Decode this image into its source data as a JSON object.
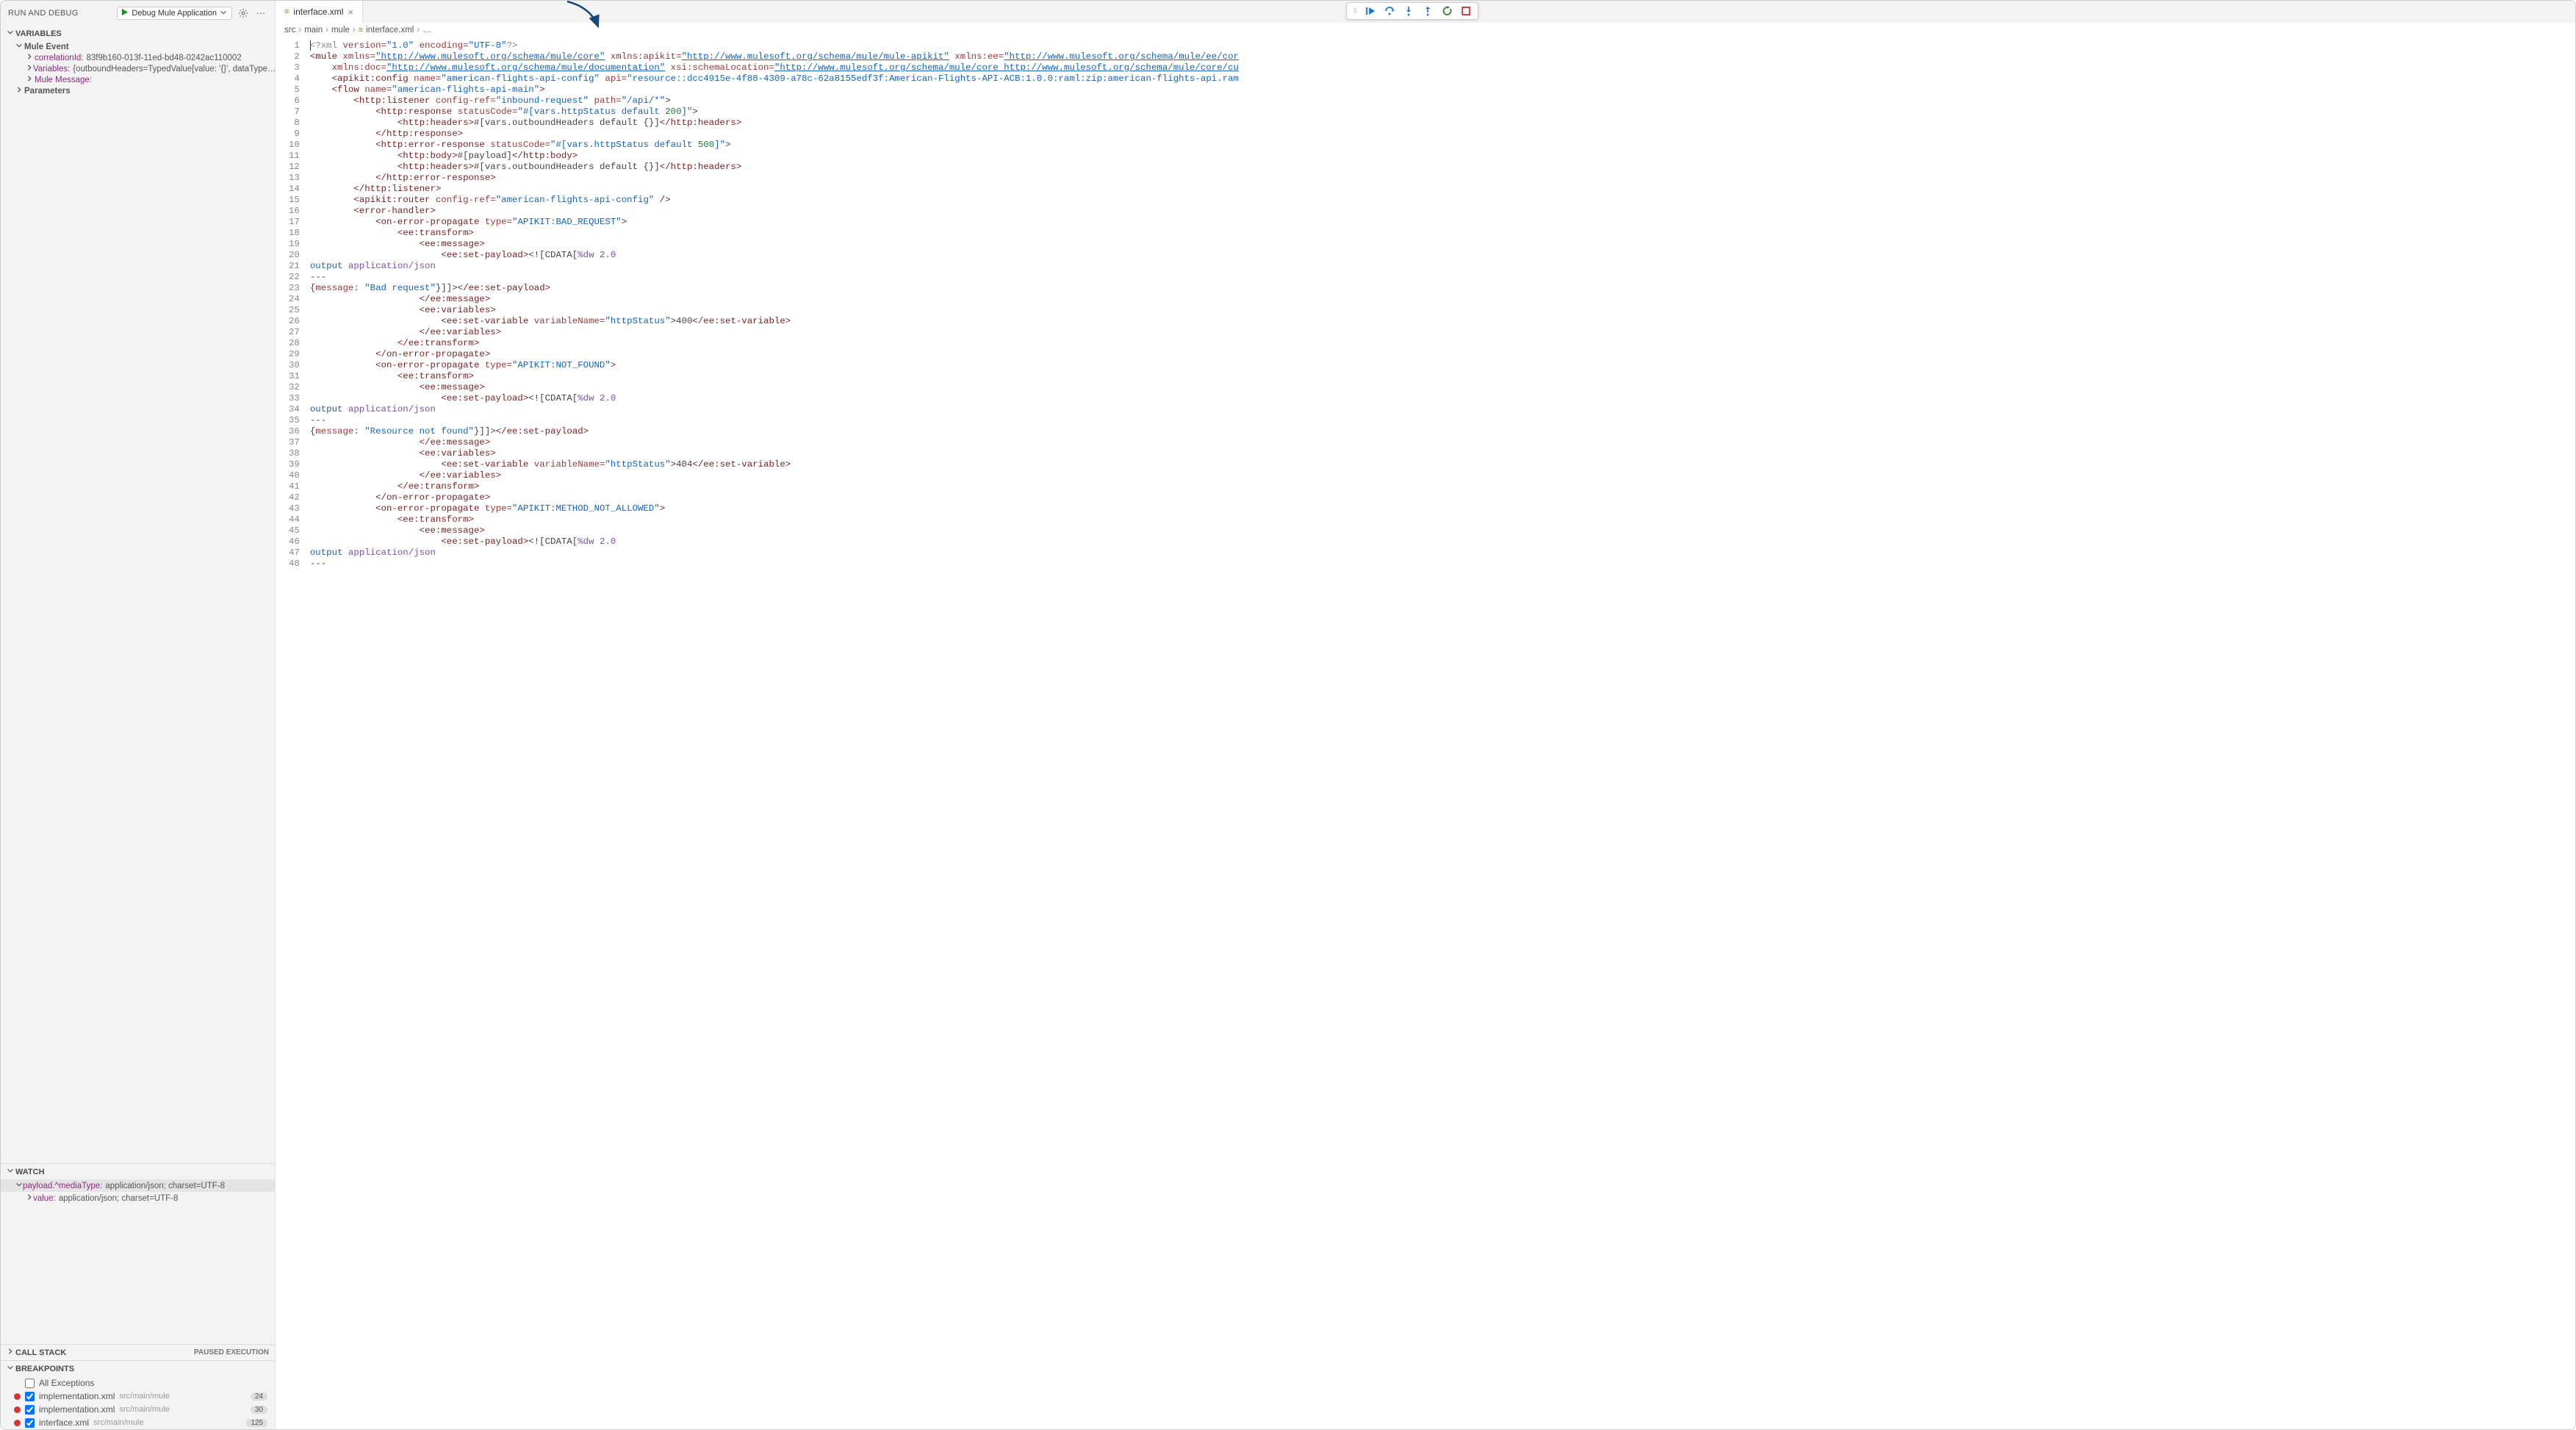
{
  "sidebar": {
    "title": "RUN AND DEBUG",
    "launch_config": "Debug Mule Application",
    "sections": {
      "variables": "VARIABLES",
      "mule_event": "Mule Event",
      "watch": "WATCH",
      "callstack": "CALL STACK",
      "callstack_status": "PAUSED EXECUTION",
      "breakpoints": "BREAKPOINTS"
    },
    "vars": {
      "correlationId_label": "correlationId:",
      "correlationId_value": "83f9b160-013f-11ed-bd48-0242ac110002",
      "variables_label": "Variables:",
      "variables_value": "{outboundHeaders=TypedValue[value: '{}', dataType…",
      "mulemsg_label": "Mule Message:",
      "parameters_label": "Parameters"
    },
    "watch": {
      "item0_key": "payload.^mediaType:",
      "item0_val": "application/json; charset=UTF-8",
      "item0_child_key": "value:",
      "item0_child_val": "application/json; charset=UTF-8"
    },
    "bp": {
      "all_exceptions": "All Exceptions",
      "items": [
        {
          "name": "implementation.xml",
          "path": "src/main/mule",
          "count": "24"
        },
        {
          "name": "implementation.xml",
          "path": "src/main/mule",
          "count": "30"
        },
        {
          "name": "interface.xml",
          "path": "src/main/mule",
          "count": "125"
        }
      ]
    }
  },
  "tab": {
    "name": "interface.xml"
  },
  "breadcrumbs": {
    "seg0": "src",
    "seg1": "main",
    "seg2": "mule",
    "seg3": "interface.xml",
    "seg4": "…"
  },
  "code": {
    "line_count": 48,
    "01": "<?xml ",
    "01b": "version=",
    "01c": "\"1.0\"",
    "01d": " encoding=",
    "01e": "\"UTF-8\"",
    "01f": "?>",
    "02a": "<mule ",
    "02b": "xmlns=",
    "02c": "\"http://www.mulesoft.org/schema/mule/core\"",
    "02d": " xmlns:apikit=",
    "02e": "\"http://www.mulesoft.org/schema/mule/mule-apikit\"",
    "02f": " xmlns:ee=",
    "02g": "\"http://www.mulesoft.org/schema/mule/ee/cor",
    "03a": "    xmlns:doc=",
    "03b": "\"http://www.mulesoft.org/schema/mule/documentation\"",
    "03c": " xsi:schemaLocation=",
    "03d": "\"http://www.mulesoft.org/schema/mule/core",
    "03e": " http://www.mulesoft.org/schema/mule/core/cu",
    "04a": "    <apikit:config ",
    "04b": "name=",
    "04c": "\"american-flights-api-config\"",
    "04d": " api=",
    "04e": "\"resource::dcc4915e-4f88-4309-a78c-62a8155edf3f:American-Flights-API-ACB:1.0.0:raml:zip:american-flights-api.ram",
    "05a": "    <flow ",
    "05b": "name=",
    "05c": "\"american-flights-api-main\"",
    "05d": ">",
    "06a": "        <http:listener ",
    "06b": "config-ref=",
    "06c": "\"inbound-request\"",
    "06d": " path=",
    "06e": "\"/api/*\"",
    "06f": ">",
    "07a": "            <http:response ",
    "07b": "statusCode=",
    "07c": "\"#[vars.httpStatus ",
    "07d": "default",
    "07e": " 200",
    "07f": "]\"",
    "07g": ">",
    "08a": "                <http:headers>",
    "08b": "#[vars.outboundHeaders default {}]",
    "08c": "</http:headers>",
    "09": "            </http:response>",
    "10a": "            <http:error-response ",
    "10b": "statusCode=",
    "10c": "\"#[vars.httpStatus ",
    "10d": "default",
    "10e": " 500",
    "10f": "]\"",
    "10g": ">",
    "11a": "                <http:body>",
    "11b": "#[payload]",
    "11c": "</http:body>",
    "12a": "                <http:headers>",
    "12b": "#[vars.outboundHeaders default {}]",
    "12c": "</http:headers>",
    "13": "            </http:error-response>",
    "14": "        </http:listener>",
    "15a": "        <apikit:router ",
    "15b": "config-ref=",
    "15c": "\"american-flights-api-config\"",
    "15d": " />",
    "16": "        <error-handler>",
    "17a": "            <on-error-propagate ",
    "17b": "type=",
    "17c": "\"APIKIT:BAD_REQUEST\"",
    "17d": ">",
    "18": "                <ee:transform>",
    "19": "                    <ee:message>",
    "20a": "                        <ee:set-payload>",
    "20b": "<![CDATA[",
    "20c": "%dw 2.0",
    "21a": "output",
    "21b": " application/json",
    "22": "---",
    "23a": "{",
    "23b": "message:",
    "23c": " \"Bad request\"",
    "23d": "}",
    "23e": "]]>",
    "23f": "</ee:set-payload>",
    "24": "                    </ee:message>",
    "25": "                    <ee:variables>",
    "26a": "                        <ee:set-variable ",
    "26b": "variableName=",
    "26c": "\"httpStatus\"",
    "26d": ">",
    "26e": "400",
    "26f": "</ee:set-variable>",
    "27": "                    </ee:variables>",
    "28": "                </ee:transform>",
    "29": "            </on-error-propagate>",
    "30a": "            <on-error-propagate ",
    "30b": "type=",
    "30c": "\"APIKIT:NOT_FOUND\"",
    "30d": ">",
    "31": "                <ee:transform>",
    "32": "                    <ee:message>",
    "33a": "                        <ee:set-payload>",
    "33b": "<![CDATA[",
    "33c": "%dw 2.0",
    "34a": "output",
    "34b": " application/json",
    "35": "---",
    "36a": "{",
    "36b": "message:",
    "36c": " \"Resource not found\"",
    "36d": "}",
    "36e": "]]>",
    "36f": "</ee:set-payload>",
    "37": "                    </ee:message>",
    "38": "                    <ee:variables>",
    "39a": "                        <ee:set-variable ",
    "39b": "variableName=",
    "39c": "\"httpStatus\"",
    "39d": ">",
    "39e": "404",
    "39f": "</ee:set-variable>",
    "40": "                    </ee:variables>",
    "41": "                </ee:transform>",
    "42": "            </on-error-propagate>",
    "43a": "            <on-error-propagate ",
    "43b": "type=",
    "43c": "\"APIKIT:METHOD_NOT_ALLOWED\"",
    "43d": ">",
    "44": "                <ee:transform>",
    "45": "                    <ee:message>",
    "46a": "                        <ee:set-payload>",
    "46b": "<![CDATA[",
    "46c": "%dw 2.0",
    "47a": "output",
    "47b": " application/json",
    "48": "---"
  }
}
